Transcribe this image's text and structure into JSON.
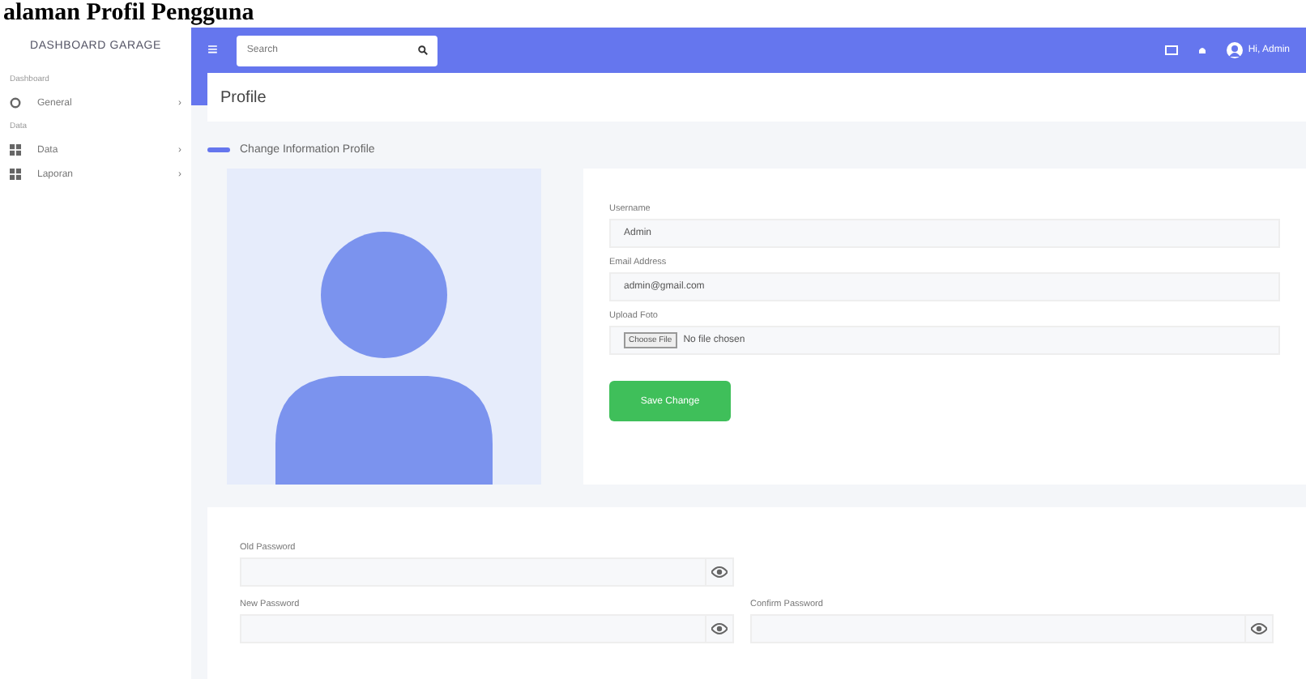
{
  "doc_heading": "alaman Profil Pengguna",
  "sidebar": {
    "brand": "DASHBOARD GARAGE",
    "sections": [
      {
        "label": "Dashboard",
        "items": [
          {
            "label": "General",
            "arrow": "›",
            "kind": "gear"
          }
        ]
      },
      {
        "label": "Data",
        "items": [
          {
            "label": "Data",
            "arrow": "›",
            "kind": "grid"
          },
          {
            "label": "Laporan",
            "arrow": "›",
            "kind": "grid"
          }
        ]
      }
    ]
  },
  "topbar": {
    "menu": "≡",
    "search": {
      "placeholder": "Search"
    },
    "user": "Hi, Admin"
  },
  "page_title": "Profile",
  "section_title": "Change Information Profile",
  "profile_form": {
    "fields": [
      {
        "label": "Username",
        "value": "Admin",
        "kind": "text"
      },
      {
        "label": "Email Address",
        "value": "admin@gmail.com",
        "kind": "text"
      },
      {
        "label": "Upload Foto",
        "button": "Choose File",
        "value": "No file chosen",
        "kind": "file"
      }
    ],
    "submit": "Save Change"
  },
  "password_form": {
    "old": {
      "label": "Old Password"
    },
    "new": {
      "label": "New Password"
    },
    "confirm": {
      "label": "Confirm Password"
    }
  }
}
